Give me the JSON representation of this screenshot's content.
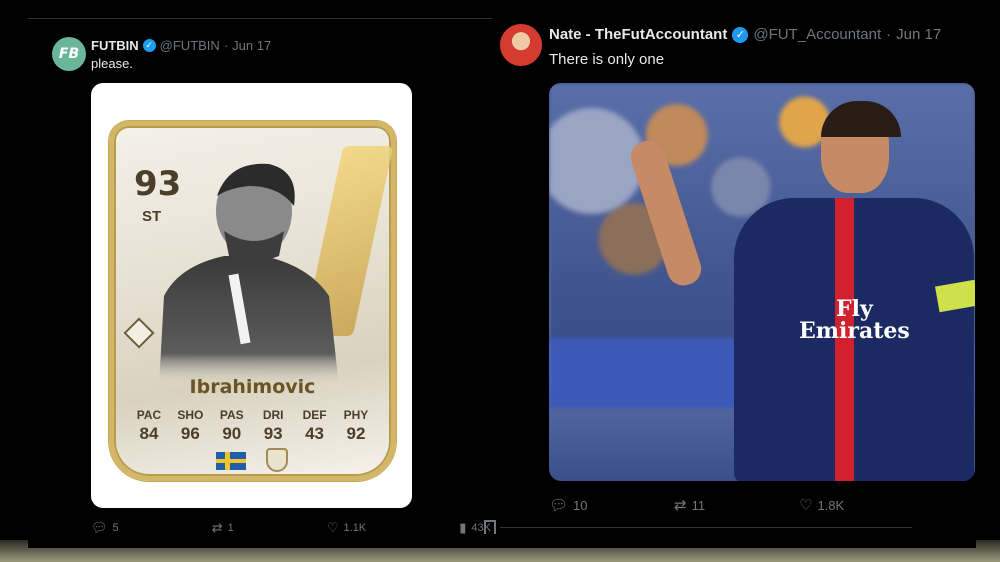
{
  "left_tweet": {
    "avatar_text": "FB",
    "display_name": "FUTBIN",
    "handle": "@FUTBIN",
    "separator": "·",
    "date": "Jun 17",
    "text": "please.",
    "card": {
      "rating": "93",
      "position": "ST",
      "name": "Ibrahimovic",
      "stats": [
        {
          "label": "PAC",
          "value": "84"
        },
        {
          "label": "SHO",
          "value": "96"
        },
        {
          "label": "PAS",
          "value": "90"
        },
        {
          "label": "DRI",
          "value": "93"
        },
        {
          "label": "DEF",
          "value": "43"
        },
        {
          "label": "PHY",
          "value": "92"
        }
      ]
    },
    "actions": {
      "replies": "5",
      "reposts": "1",
      "likes": "1.1K",
      "views": "43K"
    }
  },
  "right_tweet": {
    "display_name": "Nate - TheFutAccountant",
    "handle": "@FUT_Accountant",
    "separator": "·",
    "date": "Jun 17",
    "text": "There is only one",
    "photo_text": "Fly\nEmirates",
    "actions": {
      "replies": "10",
      "reposts": "11",
      "likes": "1.8K"
    }
  },
  "icons": {
    "reply": "reply-icon",
    "repost": "repost-icon",
    "like": "heart-icon",
    "views": "views-icon",
    "bookmark": "bookmark-icon",
    "verified": "verified-badge-icon"
  },
  "colors": {
    "verified_blue": "#1d9bf0",
    "muted_text": "#71767b",
    "card_gold": "#d2b768"
  }
}
